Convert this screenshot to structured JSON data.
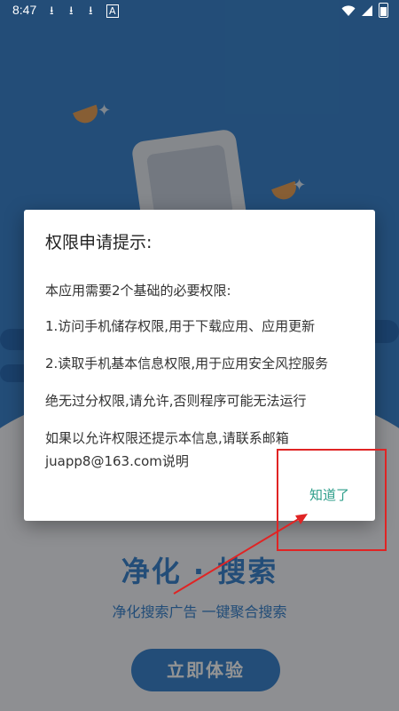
{
  "status_bar": {
    "time": "8:47",
    "download_icon": "⭳",
    "battery": "battery-icon"
  },
  "background": {
    "headline": "净化 · 搜索",
    "subline": "净化搜索广告   一键聚合搜索",
    "cta": "立即体验"
  },
  "dialog": {
    "title": "权限申请提示:",
    "lines": [
      "本应用需要2个基础的必要权限:",
      "1.访问手机储存权限,用于下载应用、应用更新",
      "2.读取手机基本信息权限,用于应用安全风控服务",
      "绝无过分权限,请允许,否则程序可能无法运行",
      "如果以允许权限还提示本信息,请联系邮箱",
      "juapp8@163.com说明"
    ],
    "ok_label": "知道了"
  },
  "colors": {
    "primary": "#3d86cf",
    "ok_text": "#2d9e8a",
    "annotation": "#e02424"
  }
}
